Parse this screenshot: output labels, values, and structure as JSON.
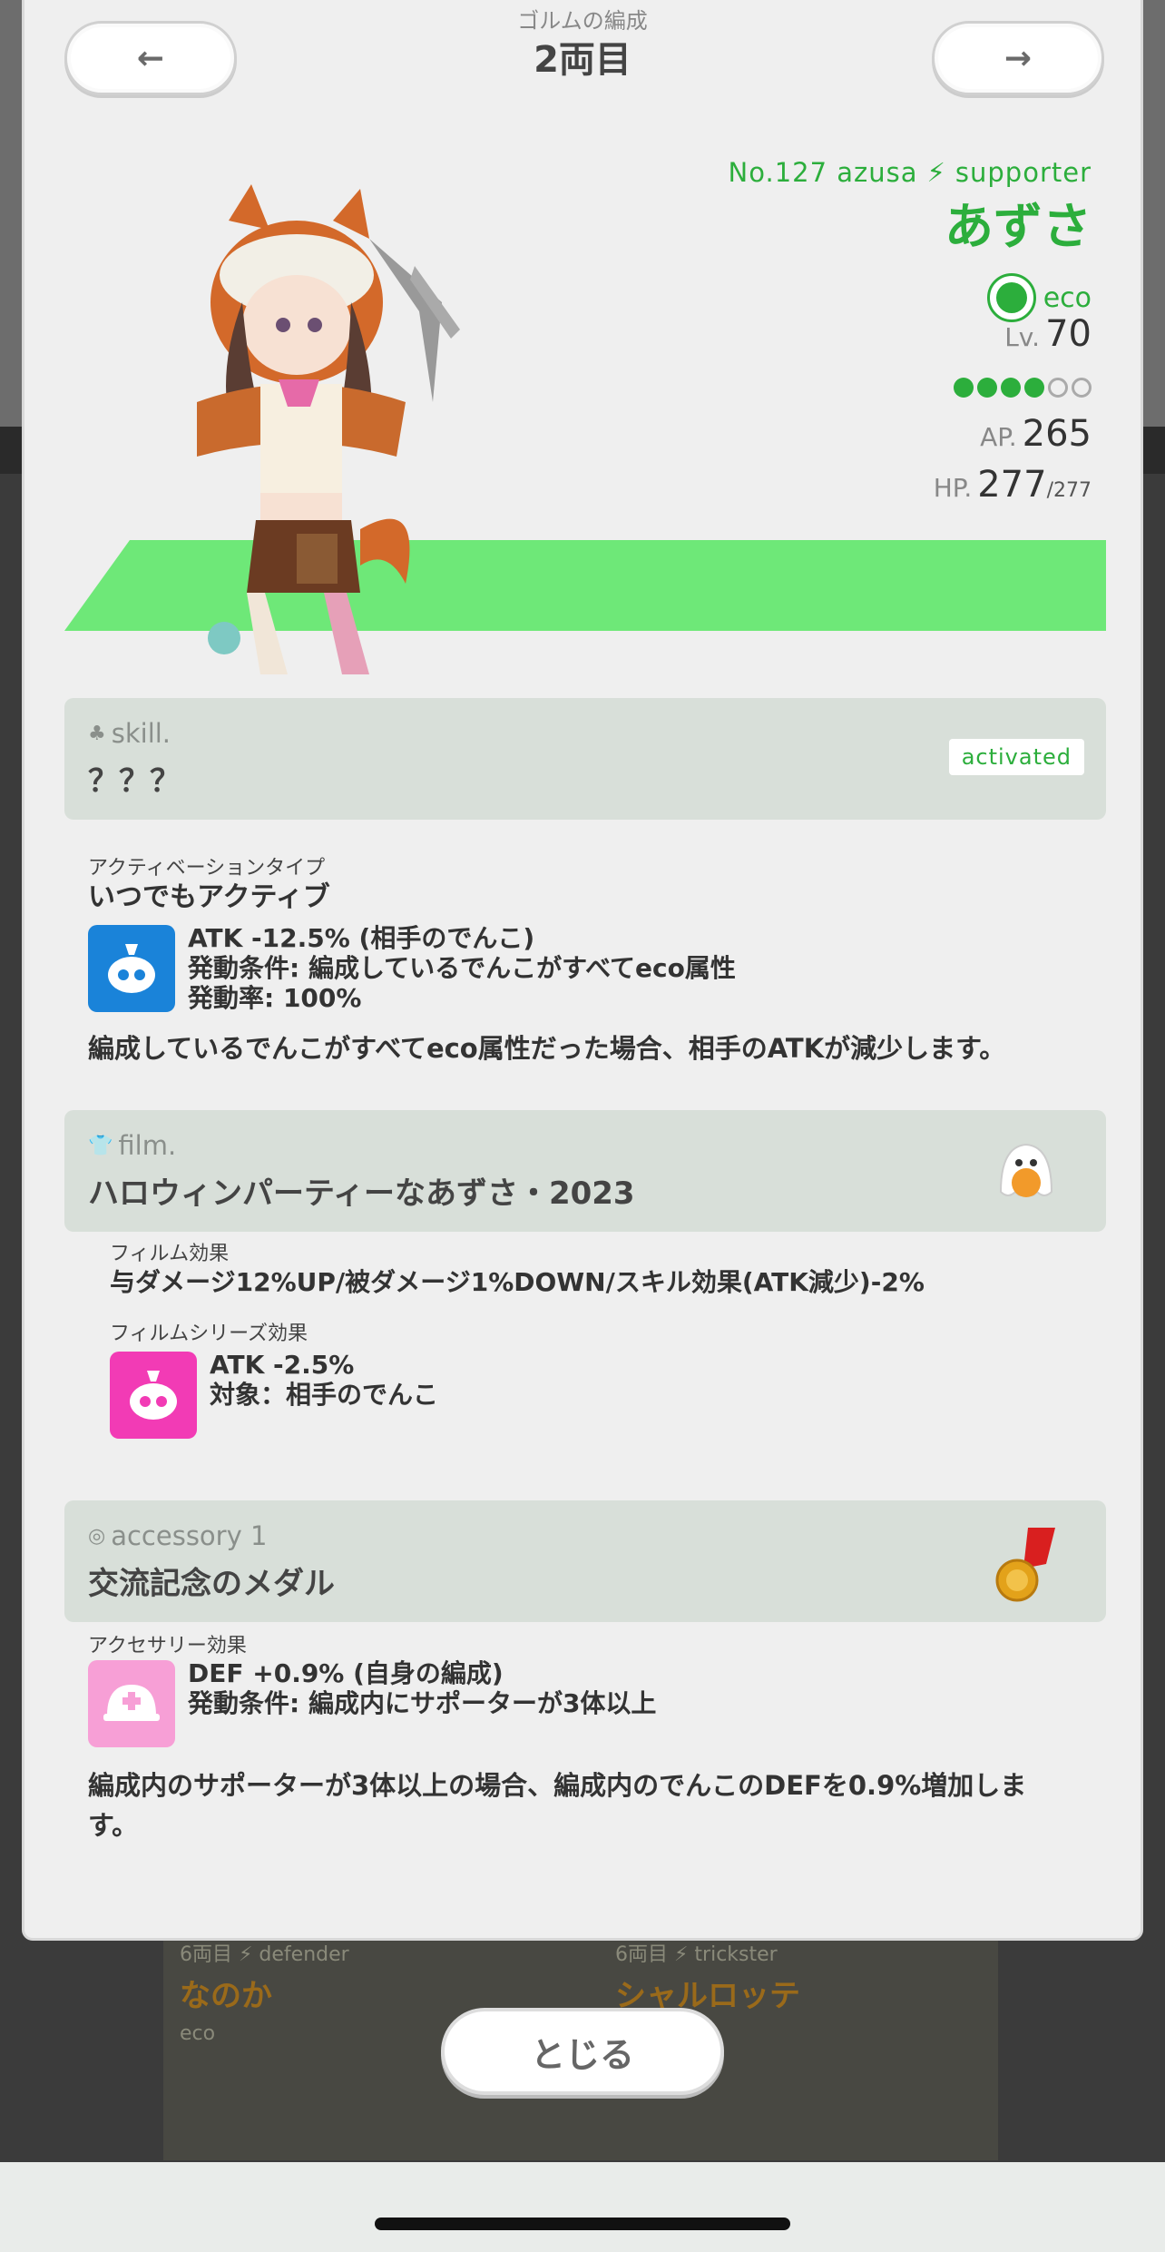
{
  "header": {
    "under_title": "ゴルムの編成",
    "car_title": "2両目",
    "prev_icon": "←",
    "next_icon": "→"
  },
  "character": {
    "number_line": "No.127 azusa",
    "role": "supporter",
    "name": "あずさ",
    "attribute": "eco",
    "level_label": "Lv.",
    "level": "70",
    "rank_dots_filled": 4,
    "rank_dots_total": 6,
    "ap_label": "AP.",
    "ap": "265",
    "hp_label": "HP.",
    "hp": "277",
    "hp_max": "/277",
    "accent_color": "#2cae3c"
  },
  "skill": {
    "label": "skill.",
    "name": "？？？",
    "status": "activated",
    "activation_type_label": "アクティベーションタイプ",
    "activation_type": "いつでもアクティブ",
    "effect_lines": [
      "ATK -12.5% (相手のでんこ)",
      "発動条件: 編成しているでんこがすべてeco属性",
      "発動率: 100%"
    ],
    "description": "編成しているでんこがすべてeco属性だった場合、相手のATKが減少します。"
  },
  "film": {
    "label": "film.",
    "name": "ハロウィンパーティーなあずさ・2023",
    "effect_label": "フィルム効果",
    "effect": "与ダメージ12%UP/被ダメージ1%DOWN/スキル効果(ATK減少)-2%",
    "series_label": "フィルムシリーズ効果",
    "series_lines": [
      "ATK -2.5%",
      "対象：相手のでんこ"
    ]
  },
  "accessory": {
    "label": "accessory 1",
    "name": "交流記念のメダル",
    "effect_label": "アクセサリー効果",
    "effect_lines": [
      "DEF +0.9% (自身の編成)",
      "発動条件: 編成内にサポーターが3体以上"
    ],
    "description_lines": [
      "編成内のサポーターが3体以上の場合、編成内のでんこのDEFを0.9%増加しま",
      "す。"
    ]
  },
  "background": {
    "card1": {
      "header": "6両目 ⚡ defender",
      "name": "なのか",
      "attribute": "eco"
    },
    "card2": {
      "header": "6両目 ⚡ trickster",
      "name": "シャルロッテ"
    }
  },
  "close_button": "とじる"
}
